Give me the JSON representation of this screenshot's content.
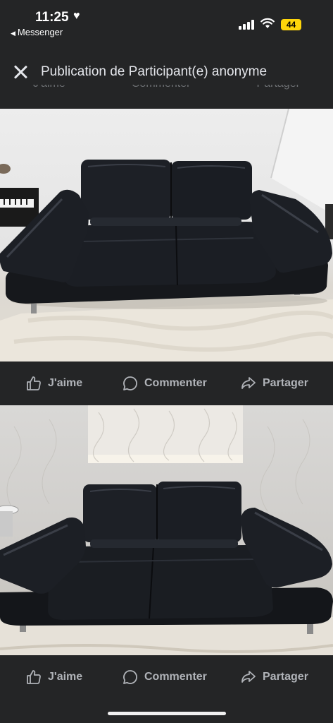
{
  "status": {
    "time": "11:25",
    "back_app": "Messenger",
    "battery": "44"
  },
  "header": {
    "title": "Publication de Participant(e) anonyme"
  },
  "actions": {
    "like": "J'aime",
    "comment": "Commenter",
    "share": "Partager"
  },
  "photos": [
    {
      "subject": "black leather sofa"
    },
    {
      "subject": "black leather sofa"
    }
  ],
  "colors": {
    "background": "#242526",
    "text": "#e4e6eb",
    "icon": "#b0b3b8",
    "battery": "#ffd60a"
  }
}
